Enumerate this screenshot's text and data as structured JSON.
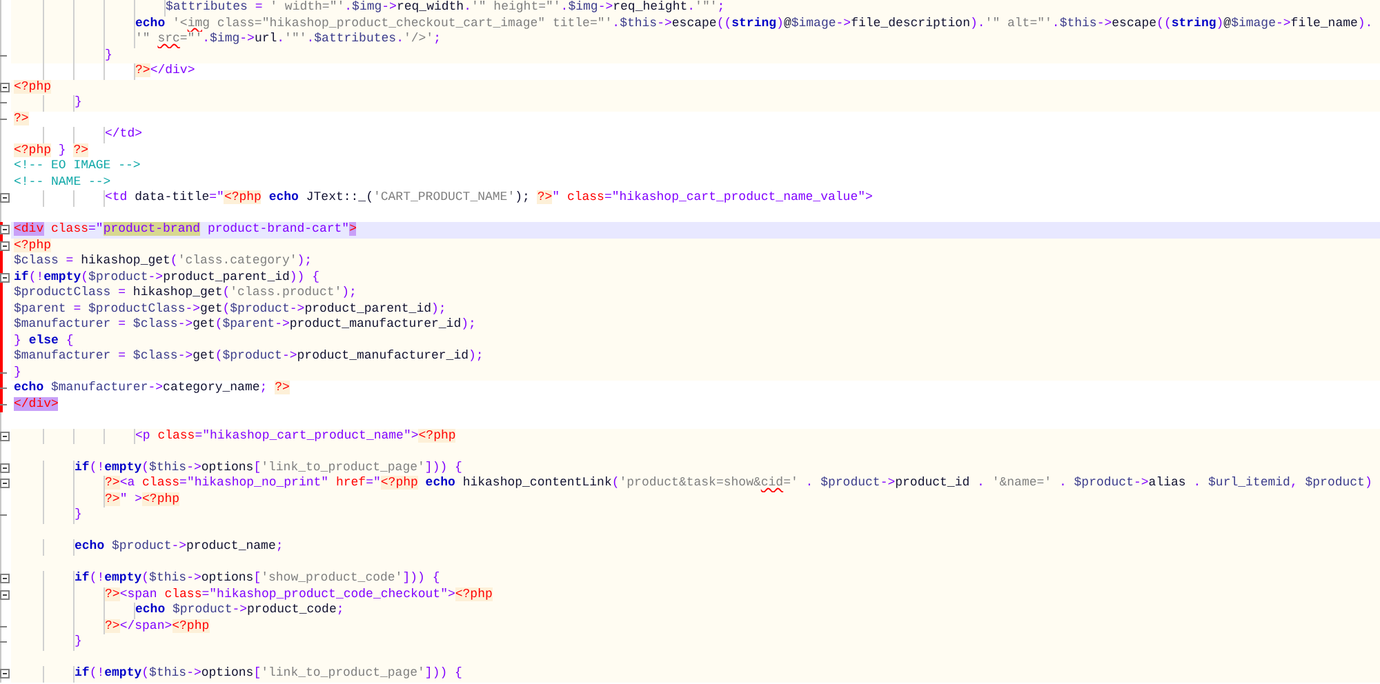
{
  "lines": [
    {
      "kind": "php",
      "current": false,
      "scope": false,
      "fold_start": false,
      "fold_end": false,
      "tokens": [
        {
          "kind": "var",
          "text": "\t\t\t\t\t$attributes"
        },
        {
          "kind": "op",
          "text": " = "
        },
        {
          "kind": "str",
          "text": "' width=\"'"
        },
        {
          "kind": "op",
          "text": "."
        },
        {
          "kind": "var",
          "text": "$img"
        },
        {
          "kind": "op",
          "text": "->"
        },
        {
          "kind": "plain",
          "text": "req_width"
        },
        {
          "kind": "op",
          "text": "."
        },
        {
          "kind": "str",
          "text": "'\" height=\"'"
        },
        {
          "kind": "op",
          "text": "."
        },
        {
          "kind": "var",
          "text": "$img"
        },
        {
          "kind": "op",
          "text": "->"
        },
        {
          "kind": "plain",
          "text": "req_height"
        },
        {
          "kind": "op",
          "text": "."
        },
        {
          "kind": "str",
          "text": "'\"'"
        },
        {
          "kind": "op",
          "text": ";"
        }
      ]
    },
    {
      "kind": "php",
      "current": false,
      "scope": false,
      "fold_start": false,
      "fold_end": false,
      "tokens": [
        {
          "kind": "kw",
          "text": "\t\t\t\techo"
        },
        {
          "kind": "str",
          "text": " '<"
        },
        {
          "kind": "miss",
          "text": "img"
        },
        {
          "kind": "str",
          "text": " class=\"hikashop_product_checkout_cart_image\" title=\"'"
        },
        {
          "kind": "op",
          "text": "."
        },
        {
          "kind": "var",
          "text": "$this"
        },
        {
          "kind": "op",
          "text": "->"
        },
        {
          "kind": "plain",
          "text": "escape"
        },
        {
          "kind": "op",
          "text": "(("
        },
        {
          "kind": "kw",
          "text": "string"
        },
        {
          "kind": "op",
          "text": ")"
        },
        {
          "kind": "plain",
          "text": "@"
        },
        {
          "kind": "var",
          "text": "$image"
        },
        {
          "kind": "op",
          "text": "->"
        },
        {
          "kind": "plain",
          "text": "file_description"
        },
        {
          "kind": "op",
          "text": ")."
        },
        {
          "kind": "str",
          "text": "'\" alt=\"'"
        },
        {
          "kind": "op",
          "text": "."
        },
        {
          "kind": "var",
          "text": "$this"
        },
        {
          "kind": "op",
          "text": "->"
        },
        {
          "kind": "plain",
          "text": "escape"
        },
        {
          "kind": "op",
          "text": "(("
        },
        {
          "kind": "kw",
          "text": "string"
        },
        {
          "kind": "op",
          "text": ")"
        },
        {
          "kind": "plain",
          "text": "@"
        },
        {
          "kind": "var",
          "text": "$image"
        },
        {
          "kind": "op",
          "text": "->"
        },
        {
          "kind": "plain",
          "text": "file_name"
        },
        {
          "kind": "op",
          "text": ")."
        }
      ]
    },
    {
      "kind": "php",
      "current": false,
      "scope": false,
      "fold_start": false,
      "fold_end": false,
      "tokens": [
        {
          "kind": "str",
          "text": "\t\t\t\t'\" "
        },
        {
          "kind": "miss",
          "text": "src"
        },
        {
          "kind": "str",
          "text": "=\"'"
        },
        {
          "kind": "op",
          "text": "."
        },
        {
          "kind": "var",
          "text": "$img"
        },
        {
          "kind": "op",
          "text": "->"
        },
        {
          "kind": "plain",
          "text": "url"
        },
        {
          "kind": "op",
          "text": "."
        },
        {
          "kind": "str",
          "text": "'\"'"
        },
        {
          "kind": "op",
          "text": "."
        },
        {
          "kind": "var",
          "text": "$attributes"
        },
        {
          "kind": "op",
          "text": "."
        },
        {
          "kind": "str",
          "text": "'/>'"
        },
        {
          "kind": "op",
          "text": ";"
        }
      ]
    },
    {
      "kind": "php",
      "current": false,
      "scope": false,
      "fold_start": false,
      "fold_end": true,
      "tokens": [
        {
          "kind": "op",
          "text": "\t\t\t}"
        }
      ]
    },
    {
      "kind": "html",
      "current": false,
      "scope": false,
      "fold_start": false,
      "fold_end": false,
      "tokens": [
        {
          "kind": "php",
          "text": "\t\t\t\t?>"
        },
        {
          "kind": "tag",
          "text": "</div>"
        }
      ]
    },
    {
      "kind": "php",
      "current": false,
      "scope": false,
      "fold_start": true,
      "fold_end": false,
      "tokens": [
        {
          "kind": "php",
          "text": "<?php"
        }
      ]
    },
    {
      "kind": "php",
      "current": false,
      "scope": false,
      "fold_start": false,
      "fold_end": true,
      "tokens": [
        {
          "kind": "op",
          "text": "\t\t}"
        }
      ]
    },
    {
      "kind": "html",
      "current": false,
      "scope": false,
      "fold_start": false,
      "fold_end": true,
      "tokens": [
        {
          "kind": "php",
          "text": "?>"
        }
      ]
    },
    {
      "kind": "html",
      "current": false,
      "scope": false,
      "fold_start": false,
      "fold_end": false,
      "tokens": [
        {
          "kind": "tag",
          "text": "\t\t\t</td>"
        }
      ]
    },
    {
      "kind": "html",
      "current": false,
      "scope": false,
      "fold_start": false,
      "fold_end": false,
      "tokens": [
        {
          "kind": "php",
          "text": "<?php"
        },
        {
          "kind": "op",
          "text": " } "
        },
        {
          "kind": "php",
          "text": "?>"
        }
      ]
    },
    {
      "kind": "html",
      "current": false,
      "scope": false,
      "fold_start": false,
      "fold_end": false,
      "tokens": [
        {
          "kind": "comment",
          "text": "<!-- EO IMAGE -->"
        }
      ]
    },
    {
      "kind": "html",
      "current": false,
      "scope": false,
      "fold_start": false,
      "fold_end": false,
      "tokens": [
        {
          "kind": "comment",
          "text": "<!-- NAME -->"
        }
      ]
    },
    {
      "kind": "html",
      "current": false,
      "scope": false,
      "fold_start": true,
      "fold_end": false,
      "tokens": [
        {
          "kind": "tag",
          "text": "\t\t\t<td "
        },
        {
          "kind": "plain",
          "text": "data-title"
        },
        {
          "kind": "op",
          "text": "="
        },
        {
          "kind": "attrval",
          "text": "\""
        },
        {
          "kind": "php",
          "text": "<?php"
        },
        {
          "kind": "kw",
          "text": " echo"
        },
        {
          "kind": "plain",
          "text": " JText::_("
        },
        {
          "kind": "str",
          "text": "'CART_PRODUCT_NAME'"
        },
        {
          "kind": "plain",
          "text": "); "
        },
        {
          "kind": "php",
          "text": "?>"
        },
        {
          "kind": "attrval",
          "text": "\" "
        },
        {
          "kind": "attr",
          "text": "class"
        },
        {
          "kind": "op",
          "text": "="
        },
        {
          "kind": "attrval",
          "text": "\"hikashop_cart_product_name_value\""
        },
        {
          "kind": "tag",
          "text": ">"
        }
      ]
    },
    {
      "kind": "html",
      "current": false,
      "scope": false,
      "fold_start": false,
      "fold_end": false
    },
    {
      "current": true,
      "scope": true,
      "fold_start": true,
      "fold_end": false,
      "tokens": [
        {
          "kind": "match",
          "text": "<div"
        },
        {
          "kind": "attr",
          "text": " class"
        },
        {
          "kind": "op",
          "text": "="
        },
        {
          "kind": "attrval",
          "text": "\""
        },
        {
          "kind": "sel",
          "text": "product-brand"
        },
        {
          "kind": "attrval",
          "text": " product-brand-cart\""
        },
        {
          "kind": "match",
          "text": ">"
        }
      ]
    },
    {
      "kind": "php",
      "current": false,
      "scope": true,
      "fold_start": true,
      "fold_end": false,
      "tokens": [
        {
          "kind": "php",
          "text": "<?php"
        }
      ]
    },
    {
      "kind": "php",
      "current": false,
      "scope": true,
      "fold_start": false,
      "fold_end": false,
      "tokens": [
        {
          "kind": "var",
          "text": "$class"
        },
        {
          "kind": "op",
          "text": " = "
        },
        {
          "kind": "plain",
          "text": "hikashop_get"
        },
        {
          "kind": "op",
          "text": "("
        },
        {
          "kind": "str",
          "text": "'class.category'"
        },
        {
          "kind": "op",
          "text": ");"
        }
      ]
    },
    {
      "kind": "php",
      "current": false,
      "scope": true,
      "fold_start": true,
      "fold_end": false,
      "tokens": [
        {
          "kind": "kw",
          "text": "if"
        },
        {
          "kind": "op",
          "text": "(!"
        },
        {
          "kind": "kw",
          "text": "empty"
        },
        {
          "kind": "op",
          "text": "("
        },
        {
          "kind": "var",
          "text": "$product"
        },
        {
          "kind": "op",
          "text": "->"
        },
        {
          "kind": "plain",
          "text": "product_parent_id"
        },
        {
          "kind": "op",
          "text": ")) {"
        }
      ]
    },
    {
      "kind": "php",
      "current": false,
      "scope": true,
      "fold_start": false,
      "fold_end": false,
      "tokens": [
        {
          "kind": "var",
          "text": "$productClass"
        },
        {
          "kind": "op",
          "text": " = "
        },
        {
          "kind": "plain",
          "text": "hikashop_get"
        },
        {
          "kind": "op",
          "text": "("
        },
        {
          "kind": "str",
          "text": "'class.product'"
        },
        {
          "kind": "op",
          "text": ");"
        }
      ]
    },
    {
      "kind": "php",
      "current": false,
      "scope": true,
      "fold_start": false,
      "fold_end": false,
      "tokens": [
        {
          "kind": "var",
          "text": "$parent"
        },
        {
          "kind": "op",
          "text": " = "
        },
        {
          "kind": "var",
          "text": "$productClass"
        },
        {
          "kind": "op",
          "text": "->"
        },
        {
          "kind": "plain",
          "text": "get"
        },
        {
          "kind": "op",
          "text": "("
        },
        {
          "kind": "var",
          "text": "$product"
        },
        {
          "kind": "op",
          "text": "->"
        },
        {
          "kind": "plain",
          "text": "product_parent_id"
        },
        {
          "kind": "op",
          "text": ");"
        }
      ]
    },
    {
      "kind": "php",
      "current": false,
      "scope": true,
      "fold_start": false,
      "fold_end": false,
      "tokens": [
        {
          "kind": "var",
          "text": "$manufacturer"
        },
        {
          "kind": "op",
          "text": " = "
        },
        {
          "kind": "var",
          "text": "$class"
        },
        {
          "kind": "op",
          "text": "->"
        },
        {
          "kind": "plain",
          "text": "get"
        },
        {
          "kind": "op",
          "text": "("
        },
        {
          "kind": "var",
          "text": "$parent"
        },
        {
          "kind": "op",
          "text": "->"
        },
        {
          "kind": "plain",
          "text": "product_manufacturer_id"
        },
        {
          "kind": "op",
          "text": ");"
        }
      ]
    },
    {
      "kind": "php",
      "current": false,
      "scope": true,
      "fold_start": false,
      "fold_end": false,
      "tokens": [
        {
          "kind": "op",
          "text": "} "
        },
        {
          "kind": "kw",
          "text": "else"
        },
        {
          "kind": "op",
          "text": " {"
        }
      ]
    },
    {
      "kind": "php",
      "current": false,
      "scope": true,
      "fold_start": false,
      "fold_end": false,
      "tokens": [
        {
          "kind": "var",
          "text": "$manufacturer"
        },
        {
          "kind": "op",
          "text": " = "
        },
        {
          "kind": "var",
          "text": "$class"
        },
        {
          "kind": "op",
          "text": "->"
        },
        {
          "kind": "plain",
          "text": "get"
        },
        {
          "kind": "op",
          "text": "("
        },
        {
          "kind": "var",
          "text": "$product"
        },
        {
          "kind": "op",
          "text": "->"
        },
        {
          "kind": "plain",
          "text": "product_manufacturer_id"
        },
        {
          "kind": "op",
          "text": ");"
        }
      ]
    },
    {
      "kind": "php",
      "current": false,
      "scope": true,
      "fold_start": false,
      "fold_end": true,
      "tokens": [
        {
          "kind": "op",
          "text": "}"
        }
      ]
    },
    {
      "kind": "html",
      "current": false,
      "scope": true,
      "fold_start": false,
      "fold_end": true,
      "tokens": [
        {
          "kind": "kw",
          "text": "echo"
        },
        {
          "kind": "var",
          "text": " $manufacturer"
        },
        {
          "kind": "op",
          "text": "->"
        },
        {
          "kind": "plain",
          "text": "category_name"
        },
        {
          "kind": "op",
          "text": "; "
        },
        {
          "kind": "php",
          "text": "?>"
        }
      ]
    },
    {
      "kind": "html",
      "current": false,
      "scope": true,
      "fold_start": false,
      "fold_end": true,
      "tokens": [
        {
          "kind": "match",
          "text": "</div>"
        }
      ]
    },
    {
      "kind": "html",
      "current": false,
      "scope": false,
      "fold_start": false,
      "fold_end": false
    },
    {
      "kind": "php",
      "current": false,
      "scope": false,
      "fold_start": true,
      "fold_end": false,
      "tokens": [
        {
          "kind": "tag",
          "text": "\t\t\t\t<p "
        },
        {
          "kind": "attr",
          "text": "class"
        },
        {
          "kind": "op",
          "text": "="
        },
        {
          "kind": "attrval",
          "text": "\"hikashop_cart_product_name\""
        },
        {
          "kind": "tag",
          "text": ">"
        },
        {
          "kind": "php",
          "text": "<?php"
        }
      ]
    },
    {
      "kind": "php",
      "current": false,
      "scope": false,
      "fold_start": false,
      "fold_end": false
    },
    {
      "kind": "php",
      "current": false,
      "scope": false,
      "fold_start": true,
      "fold_end": false,
      "tokens": [
        {
          "kind": "kw",
          "text": "\t\tif"
        },
        {
          "kind": "op",
          "text": "(!"
        },
        {
          "kind": "kw",
          "text": "empty"
        },
        {
          "kind": "op",
          "text": "("
        },
        {
          "kind": "var",
          "text": "$this"
        },
        {
          "kind": "op",
          "text": "->"
        },
        {
          "kind": "plain",
          "text": "options"
        },
        {
          "kind": "op",
          "text": "["
        },
        {
          "kind": "str",
          "text": "'link_to_product_page'"
        },
        {
          "kind": "op",
          "text": "])) {"
        }
      ]
    },
    {
      "kind": "php",
      "current": false,
      "scope": false,
      "fold_start": true,
      "fold_end": false,
      "tokens": [
        {
          "kind": "php",
          "text": "\t\t\t?>"
        },
        {
          "kind": "tag",
          "text": "<a "
        },
        {
          "kind": "attr",
          "text": "class"
        },
        {
          "kind": "op",
          "text": "="
        },
        {
          "kind": "attrval",
          "text": "\"hikashop_no_print\" "
        },
        {
          "kind": "attr",
          "text": "href"
        },
        {
          "kind": "op",
          "text": "="
        },
        {
          "kind": "attrval",
          "text": "\""
        },
        {
          "kind": "php",
          "text": "<?php"
        },
        {
          "kind": "kw",
          "text": " echo"
        },
        {
          "kind": "plain",
          "text": " hikashop_contentLink"
        },
        {
          "kind": "op",
          "text": "("
        },
        {
          "kind": "str",
          "text": "'product&task=show&"
        },
        {
          "kind": "miss",
          "text": "cid"
        },
        {
          "kind": "str",
          "text": "='"
        },
        {
          "kind": "op",
          "text": " . "
        },
        {
          "kind": "var",
          "text": "$product"
        },
        {
          "kind": "op",
          "text": "->"
        },
        {
          "kind": "plain",
          "text": "product_id"
        },
        {
          "kind": "op",
          "text": " . "
        },
        {
          "kind": "str",
          "text": "'&name='"
        },
        {
          "kind": "op",
          "text": " . "
        },
        {
          "kind": "var",
          "text": "$product"
        },
        {
          "kind": "op",
          "text": "->"
        },
        {
          "kind": "plain",
          "text": "alias"
        },
        {
          "kind": "op",
          "text": " . "
        },
        {
          "kind": "var",
          "text": "$url_itemid"
        },
        {
          "kind": "op",
          "text": ", "
        },
        {
          "kind": "var",
          "text": "$product"
        },
        {
          "kind": "op",
          "text": ")"
        }
      ]
    },
    {
      "kind": "php",
      "current": false,
      "scope": false,
      "fold_start": false,
      "fold_end": false,
      "tokens": [
        {
          "kind": "php",
          "text": "\t\t\t?>"
        },
        {
          "kind": "attrval",
          "text": "\" >"
        },
        {
          "kind": "php",
          "text": "<?php"
        }
      ]
    },
    {
      "kind": "php",
      "current": false,
      "scope": false,
      "fold_start": false,
      "fold_end": true,
      "tokens": [
        {
          "kind": "op",
          "text": "\t\t}"
        }
      ]
    },
    {
      "kind": "php",
      "current": false,
      "scope": false,
      "fold_start": false,
      "fold_end": false
    },
    {
      "kind": "php",
      "current": false,
      "scope": false,
      "fold_start": false,
      "fold_end": false,
      "tokens": [
        {
          "kind": "kw",
          "text": "\t\techo"
        },
        {
          "kind": "var",
          "text": " $product"
        },
        {
          "kind": "op",
          "text": "->"
        },
        {
          "kind": "plain",
          "text": "product_name"
        },
        {
          "kind": "op",
          "text": ";"
        }
      ]
    },
    {
      "kind": "php",
      "current": false,
      "scope": false,
      "fold_start": false,
      "fold_end": false
    },
    {
      "kind": "php",
      "current": false,
      "scope": false,
      "fold_start": true,
      "fold_end": false,
      "tokens": [
        {
          "kind": "kw",
          "text": "\t\tif"
        },
        {
          "kind": "op",
          "text": "(!"
        },
        {
          "kind": "kw",
          "text": "empty"
        },
        {
          "kind": "op",
          "text": "("
        },
        {
          "kind": "var",
          "text": "$this"
        },
        {
          "kind": "op",
          "text": "->"
        },
        {
          "kind": "plain",
          "text": "options"
        },
        {
          "kind": "op",
          "text": "["
        },
        {
          "kind": "str",
          "text": "'show_product_code'"
        },
        {
          "kind": "op",
          "text": "])) {"
        }
      ]
    },
    {
      "kind": "php",
      "current": false,
      "scope": false,
      "fold_start": true,
      "fold_end": false,
      "tokens": [
        {
          "kind": "php",
          "text": "\t\t\t?>"
        },
        {
          "kind": "tag",
          "text": "<span "
        },
        {
          "kind": "attr",
          "text": "class"
        },
        {
          "kind": "op",
          "text": "="
        },
        {
          "kind": "attrval",
          "text": "\"hikashop_product_code_checkout\""
        },
        {
          "kind": "tag",
          "text": ">"
        },
        {
          "kind": "php",
          "text": "<?php"
        }
      ]
    },
    {
      "kind": "php",
      "current": false,
      "scope": false,
      "fold_start": false,
      "fold_end": false,
      "tokens": [
        {
          "kind": "kw",
          "text": "\t\t\t\techo"
        },
        {
          "kind": "var",
          "text": " $product"
        },
        {
          "kind": "op",
          "text": "->"
        },
        {
          "kind": "plain",
          "text": "product_code"
        },
        {
          "kind": "op",
          "text": ";"
        }
      ]
    },
    {
      "kind": "php",
      "current": false,
      "scope": false,
      "fold_start": false,
      "fold_end": true,
      "tokens": [
        {
          "kind": "php",
          "text": "\t\t\t?>"
        },
        {
          "kind": "tag",
          "text": "</span>"
        },
        {
          "kind": "php",
          "text": "<?php"
        }
      ]
    },
    {
      "kind": "php",
      "current": false,
      "scope": false,
      "fold_start": false,
      "fold_end": true,
      "tokens": [
        {
          "kind": "op",
          "text": "\t\t}"
        }
      ]
    },
    {
      "kind": "php",
      "current": false,
      "scope": false,
      "fold_start": false,
      "fold_end": false
    },
    {
      "kind": "php",
      "current": false,
      "scope": false,
      "fold_start": true,
      "fold_end": false,
      "tokens": [
        {
          "kind": "kw",
          "text": "\t\tif"
        },
        {
          "kind": "op",
          "text": "(!"
        },
        {
          "kind": "kw",
          "text": "empty"
        },
        {
          "kind": "op",
          "text": "("
        },
        {
          "kind": "var",
          "text": "$this"
        },
        {
          "kind": "op",
          "text": "->"
        },
        {
          "kind": "plain",
          "text": "options"
        },
        {
          "kind": "op",
          "text": "["
        },
        {
          "kind": "str",
          "text": "'link_to_product_page'"
        },
        {
          "kind": "op",
          "text": "])) {"
        }
      ]
    }
  ]
}
